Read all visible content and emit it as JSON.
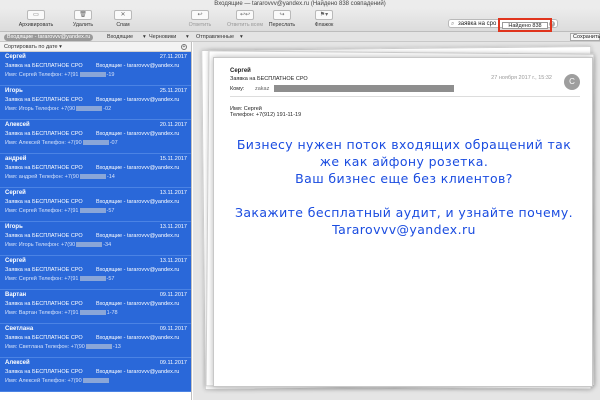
{
  "window": {
    "title": "Входящие — tararovvv@yandex.ru (Найдено 838 совпадений)"
  },
  "toolbar": {
    "archive": "Архивировать",
    "delete": "Удалить",
    "spam": "Спам",
    "reply": "Ответить",
    "reply_all": "Ответить всем",
    "forward": "Переслать",
    "flag": "Флажок"
  },
  "search": {
    "query": "заявка на сро",
    "found": "Найдено 838"
  },
  "save_button": "Сохранить",
  "favorites": {
    "mailbox": "Входящие - tararovvv@yandex.ru",
    "inbox": "Входящие",
    "drafts": "Черновики",
    "sent": "Отправленные"
  },
  "list": {
    "sort": "Сортировать по дате",
    "messages": [
      {
        "sender": "Сергей",
        "date": "27.11.2017",
        "subject": "Заявка на БЕСПЛАТНОЕ СРО",
        "mailbox": "Входящие - tararovvv@yandex.ru",
        "preview_a": "Имя: Сергей Телефон: +7(91",
        "preview_b": "-19"
      },
      {
        "sender": "Игорь",
        "date": "25.11.2017",
        "subject": "Заявка на БЕСПЛАТНОЕ СРО",
        "mailbox": "Входящие - tararovvv@yandex.ru",
        "preview_a": "Имя: Игорь Телефон: +7(90",
        "preview_b": "-02"
      },
      {
        "sender": "Алексей",
        "date": "20.11.2017",
        "subject": "Заявка на БЕСПЛАТНОЕ СРО",
        "mailbox": "Входящие - tararovvv@yandex.ru",
        "preview_a": "Имя: Алексей Телефон: +7(90",
        "preview_b": "-07"
      },
      {
        "sender": "андрей",
        "date": "15.11.2017",
        "subject": "Заявка на БЕСПЛАТНОЕ СРО",
        "mailbox": "Входящие - tararovvv@yandex.ru",
        "preview_a": "Имя: андрей Телефон: +7(90",
        "preview_b": "-14"
      },
      {
        "sender": "Сергей",
        "date": "13.11.2017",
        "subject": "Заявка на БЕСПЛАТНОЕ СРО",
        "mailbox": "Входящие - tararovvv@yandex.ru",
        "preview_a": "Имя: Сергей Телефон: +7(91",
        "preview_b": "-57"
      },
      {
        "sender": "Игорь",
        "date": "13.11.2017",
        "subject": "Заявка на БЕСПЛАТНОЕ СРО",
        "mailbox": "Входящие - tararovvv@yandex.ru",
        "preview_a": "Имя: Игорь Телефон: +7(90",
        "preview_b": "-34"
      },
      {
        "sender": "Сергей",
        "date": "13.11.2017",
        "subject": "Заявка на БЕСПЛАТНОЕ СРО",
        "mailbox": "Входящие - tararovvv@yandex.ru",
        "preview_a": "Имя: Сергей Телефон: +7(91",
        "preview_b": "-57"
      },
      {
        "sender": "Вартан",
        "date": "09.11.2017",
        "subject": "Заявка на БЕСПЛАТНОЕ СРО",
        "mailbox": "Входящие - tararovvv@yandex.ru",
        "preview_a": "Имя: Вартан Телефон: +7(91",
        "preview_b": "1-78"
      },
      {
        "sender": "Светлана",
        "date": "09.11.2017",
        "subject": "Заявка на БЕСПЛАТНОЕ СРО",
        "mailbox": "Входящие - tararovvv@yandex.ru",
        "preview_a": "Имя: Светлана Телефон: +7(90",
        "preview_b": "-13"
      },
      {
        "sender": "Алексей",
        "date": "09.11.2017",
        "subject": "Заявка на БЕСПЛАТНОЕ СРО",
        "mailbox": "Входящие - tararovvv@yandex.ru",
        "preview_a": "Имя: Алексей Телефон: +7(90",
        "preview_b": ""
      }
    ]
  },
  "message": {
    "from": "Сергей",
    "subject": "Заявка на БЕСПЛАТНОЕ СРО",
    "to_label": "Кому:",
    "to_value": "zakaz",
    "date": "27 ноября 2017 г., 15:32",
    "avatar_initial": "С",
    "body_name": "Имя: Сергей",
    "body_phone": "Телефон: +7(912) 191-11-19"
  },
  "promo": {
    "line1": "Бизнесу нужен поток входящих обращений так",
    "line2": "же как айфону розетка.",
    "line3": "Ваш бизнес еще без клиентов?",
    "line4": "Закажите бесплатный аудит, и узнайте почему.",
    "line5": "Tararovvv@yandex.ru"
  },
  "colors": {
    "selection": "#2a68d9",
    "promo_text": "#1a4ce0",
    "highlight_box": "#e0341d"
  }
}
